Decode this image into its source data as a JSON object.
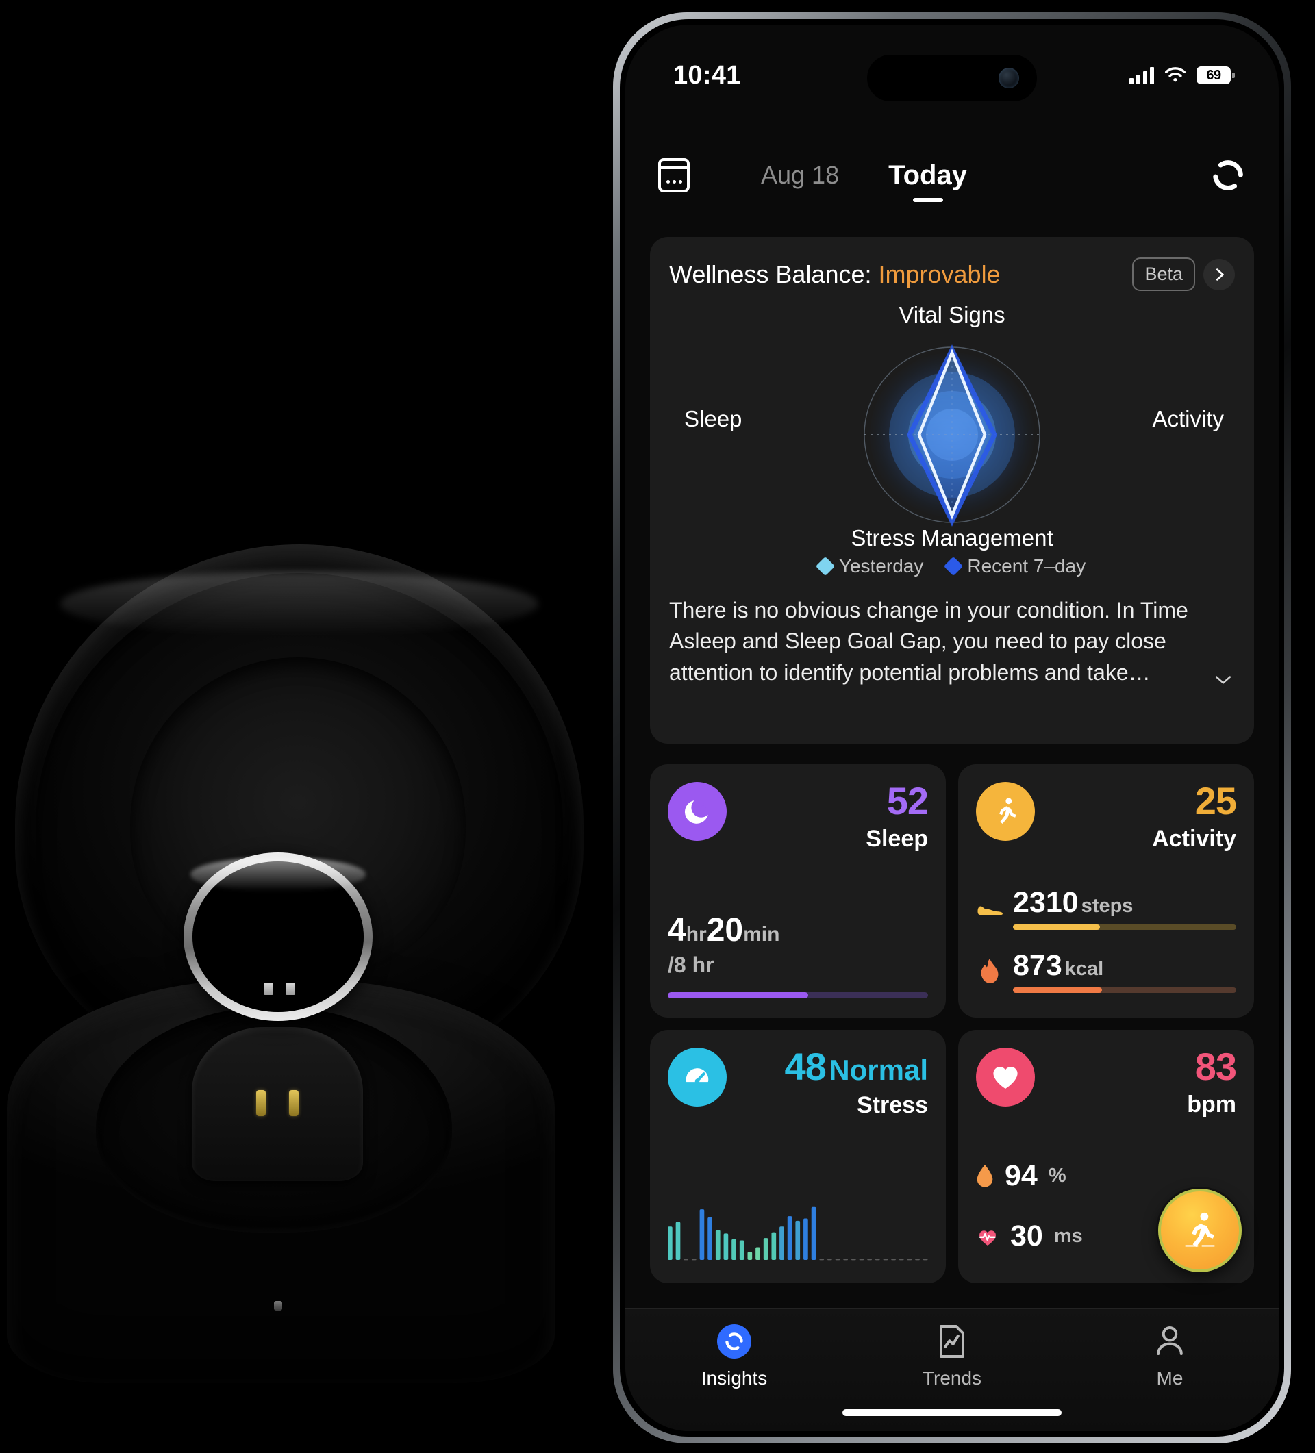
{
  "status_bar": {
    "time": "10:41",
    "battery_level": "69",
    "signal_icon": "cellular-signal-icon",
    "wifi_icon": "wifi-icon",
    "battery_icon": "battery-icon"
  },
  "header": {
    "calendar_icon": "calendar-icon",
    "previous_date": "Aug 18",
    "current_tab": "Today",
    "sync_icon": "sync-icon"
  },
  "wellness": {
    "title_prefix": "Wellness Balance: ",
    "status": "Improvable",
    "status_color": "#ef9b3d",
    "beta_badge": "Beta",
    "chevron_icon": "chevron-right-icon",
    "axes": {
      "top": "Vital Signs",
      "left": "Sleep",
      "right": "Activity",
      "bottom": "Stress Management"
    },
    "legend": [
      {
        "label": "Yesterday",
        "color": "#7fd4f0"
      },
      {
        "label": "Recent 7–day",
        "color": "#2b5ae8"
      }
    ],
    "description": "There is no obvious change in your condition. In Time Asleep and Sleep Goal Gap, you need to pay close attention to identify potential problems and take…",
    "expand_icon": "chevron-down-icon"
  },
  "chart_data": [
    {
      "type": "radar",
      "title": "Wellness Balance",
      "categories": [
        "Vital Signs",
        "Activity",
        "Stress Management",
        "Sleep"
      ],
      "series": [
        {
          "name": "Yesterday",
          "color": "#7fd4f0",
          "values": [
            96,
            46,
            92,
            44
          ]
        },
        {
          "name": "Recent 7–day",
          "color": "#2b5ae8",
          "values": [
            88,
            52,
            86,
            50
          ]
        }
      ],
      "rlim": [
        0,
        100
      ],
      "grid": true,
      "legend_position": "bottom"
    },
    {
      "type": "bar",
      "title": "Stress",
      "ylabel": "",
      "xlabel": "",
      "ylim": [
        0,
        100
      ],
      "values": [
        58,
        66,
        0,
        0,
        88,
        74,
        52,
        46,
        36,
        34,
        14,
        22,
        38,
        48,
        58,
        76,
        68,
        72,
        92
      ],
      "colors": [
        "#4fc8c0",
        "#4fc8c0",
        "#000000",
        "#000000",
        "#2f7fe0",
        "#2f7fe0",
        "#52c9b6",
        "#4fc8c0",
        "#52c9b6",
        "#52c9b6",
        "#6ed6a8",
        "#6ed6a8",
        "#5ccdb0",
        "#52c9b6",
        "#3f9fd0",
        "#2f7fe0",
        "#3f9fd0",
        "#2f7fe0",
        "#2f7fe0"
      ],
      "trailing_dots": 28
    }
  ],
  "metrics": {
    "sleep": {
      "icon": "moon-sleep-icon",
      "icon_color": "#9b59f0",
      "score": "52",
      "score_color": "#a36bf5",
      "label": "Sleep",
      "duration_hours": "4",
      "duration_hours_unit": "hr",
      "duration_minutes": "20",
      "duration_minutes_unit": "min",
      "goal": "/8 hr",
      "progress_percent": 54,
      "bar_color": "#9b59f0",
      "track_color": "#3b2f57"
    },
    "activity": {
      "icon": "running-person-icon",
      "icon_color": "#f5b53c",
      "score": "25",
      "score_color": "#f0ad38",
      "label": "Activity",
      "rows": [
        {
          "icon": "shoe-icon",
          "value": "2310",
          "unit": "steps",
          "progress_percent": 39,
          "bar_color": "#f5bf4a",
          "track_color": "#5a4c27"
        },
        {
          "icon": "flame-icon",
          "value": "873",
          "unit": "kcal",
          "progress_percent": 40,
          "bar_color": "#f07a45",
          "track_color": "#553a2e"
        }
      ]
    },
    "stress": {
      "icon": "gauge-icon",
      "icon_color": "#2bc0e4",
      "score": "48",
      "status": "Normal",
      "score_color": "#2bc0e4",
      "label": "Stress"
    },
    "heart": {
      "icon": "heart-icon",
      "icon_color": "#ef4b6e",
      "score": "83",
      "score_color": "#f2557a",
      "label": "bpm",
      "rows": [
        {
          "icon": "blood-drop-icon",
          "value": "94",
          "unit": "%",
          "icon_color": "#f59a4a"
        },
        {
          "icon": "heart-pulse-icon",
          "value": "30",
          "unit": "ms",
          "icon_color": "#f2557a"
        }
      ],
      "fab_icon": "running-person-icon"
    }
  },
  "tabbar": {
    "items": [
      {
        "label": "Insights",
        "icon": "insights-ring-icon",
        "active": true
      },
      {
        "label": "Trends",
        "icon": "trends-chart-icon",
        "active": false
      },
      {
        "label": "Me",
        "icon": "person-icon",
        "active": false
      }
    ]
  }
}
